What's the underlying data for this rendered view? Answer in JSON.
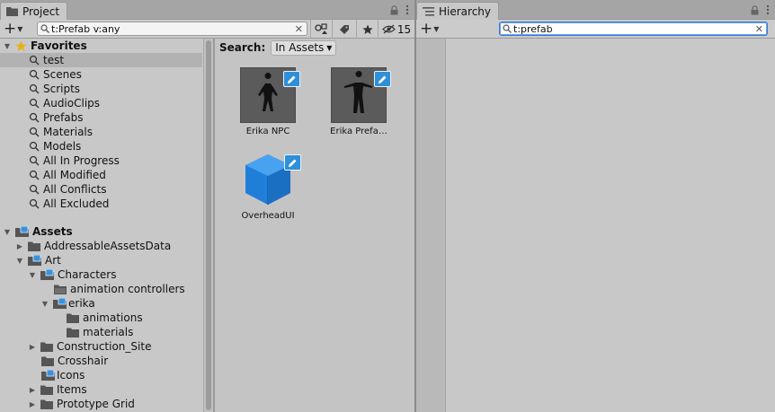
{
  "project": {
    "tab_label": "Project",
    "search_value": "t:Prefab v:any",
    "hidden_count": "15",
    "scope": {
      "label": "Search:",
      "value": "In Assets"
    },
    "favorites": {
      "label": "Favorites",
      "items": [
        "test",
        "Scenes",
        "Scripts",
        "AudioClips",
        "Prefabs",
        "Materials",
        "Models",
        "All In Progress",
        "All Modified",
        "All Conflicts",
        "All Excluded"
      ]
    },
    "assets_label": "Assets",
    "tree": [
      "AddressableAssetsData",
      "Art",
      "Characters",
      "animation controllers",
      "erika",
      "animations",
      "materials",
      "Construction_Site",
      "Crosshair",
      "Icons",
      "Items",
      "Prototype Grid"
    ],
    "grid": [
      {
        "label": "Erika NPC"
      },
      {
        "label": "Erika Prefa…"
      },
      {
        "label": "OverheadUI"
      }
    ]
  },
  "hierarchy": {
    "tab_label": "Hierarchy",
    "search_value": "t:prefab"
  },
  "colors": {
    "accent": "#2f8fd8",
    "cube_blue": "#1f7ed8",
    "focus": "#3a79d7"
  }
}
